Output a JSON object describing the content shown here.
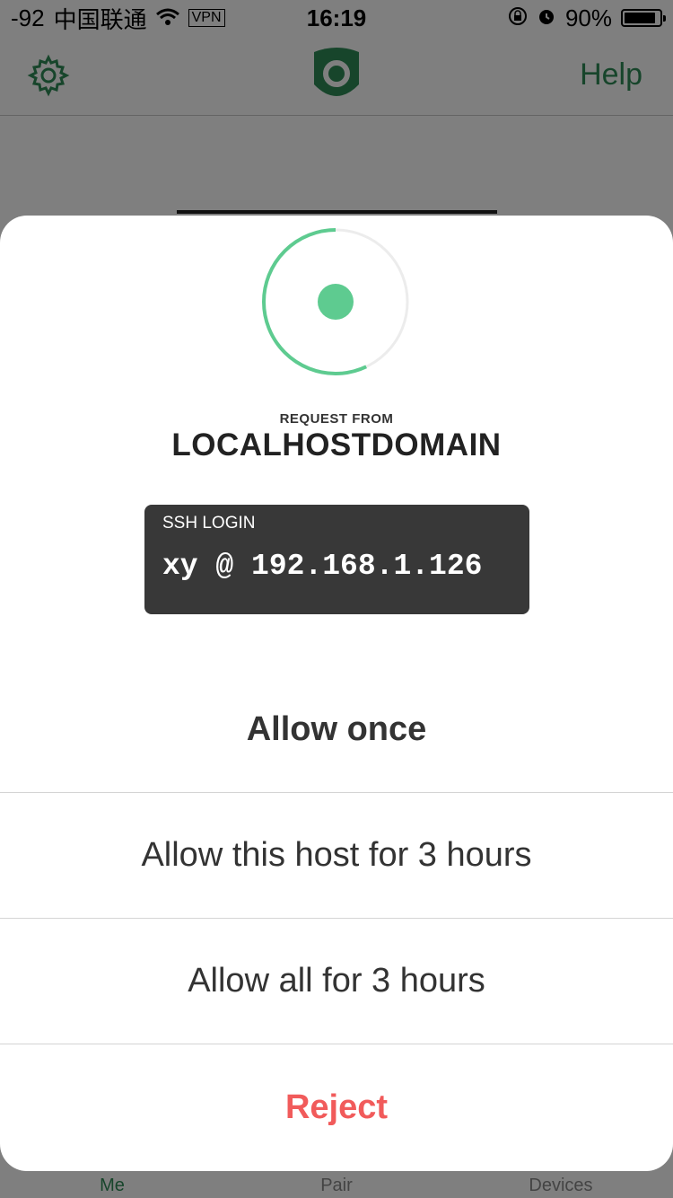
{
  "status_bar": {
    "signal": "-92",
    "carrier": "中国联通",
    "vpn": "VPN",
    "time": "16:19",
    "battery": "90%",
    "battery_level": 0.9
  },
  "nav": {
    "help": "Help",
    "settings_icon": "gear-icon",
    "logo_icon": "shield-logo-icon"
  },
  "request": {
    "label": "REQUEST FROM",
    "host": "LOCALHOSTDOMAIN",
    "spinner_progress": 0.57
  },
  "ssh": {
    "title": "SSH LOGIN",
    "value": "xy @ 192.168.1.126"
  },
  "actions": {
    "allow_once": "Allow once",
    "allow_host": "Allow this host for 3 hours",
    "allow_all": "Allow all for 3 hours",
    "reject": "Reject"
  },
  "tabs": [
    "Me",
    "Pair",
    "Devices"
  ],
  "colors": {
    "accent": "#5ecb90",
    "brand_green": "#2e8b57",
    "reject": "#f15b5b",
    "card": "#383838"
  }
}
